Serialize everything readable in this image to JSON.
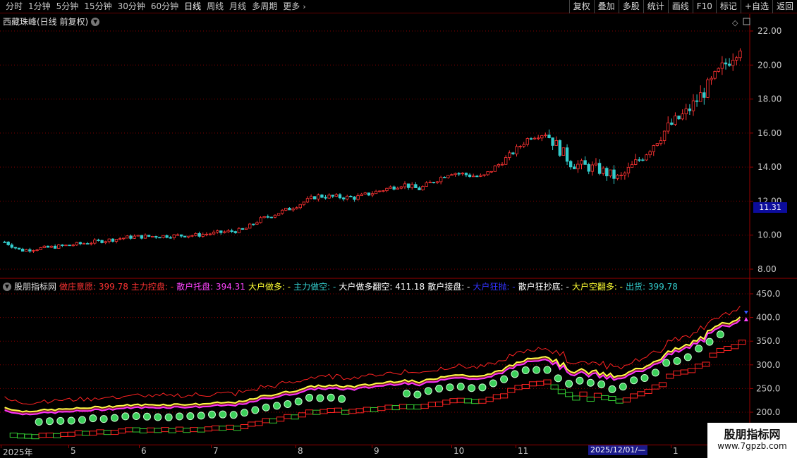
{
  "toolbar": {
    "periods": [
      "分时",
      "1分钟",
      "5分钟",
      "15分钟",
      "30分钟",
      "60分钟",
      "日线",
      "周线",
      "月线",
      "多周期",
      "更多"
    ],
    "active_period": "日线",
    "tools": [
      "复权",
      "叠加",
      "多股",
      "统计",
      "画线",
      "F10",
      "标记",
      "+自选",
      "返回"
    ]
  },
  "main": {
    "title": "西藏珠峰(日线 前复权)",
    "price_tag": "11.31",
    "y_ticks": [
      "22.00",
      "20.00",
      "18.00",
      "16.00",
      "14.00",
      "12.00",
      "10.00",
      "8.00"
    ]
  },
  "indicator": {
    "name": "股朋指标网",
    "items": [
      {
        "text": "做庄意愿: 399.78",
        "color": "#ff3333"
      },
      {
        "text": "主力控盘: -",
        "color": "#ff3333"
      },
      {
        "text": "散户托盘: 394.31",
        "color": "#ff44ff"
      },
      {
        "text": "大户做多: -",
        "color": "#ffff33"
      },
      {
        "text": "主力做空: -",
        "color": "#33cccc"
      },
      {
        "text": "大户做多翻空: 411.18",
        "color": "#ffffff"
      },
      {
        "text": "散户接盘: -",
        "color": "#ffffff"
      },
      {
        "text": "大户狂抛: -",
        "color": "#3333ff"
      },
      {
        "text": "散户狂抄底: -",
        "color": "#ffffff"
      },
      {
        "text": "大户空翻多: -",
        "color": "#ffff33"
      },
      {
        "text": "出货: 399.78",
        "color": "#33cccc"
      }
    ],
    "y_ticks": [
      "450.0",
      "400.0",
      "350.0",
      "300.0",
      "250.0",
      "200.0"
    ]
  },
  "xaxis": {
    "labels": [
      "2025年",
      "5",
      "6",
      "7",
      "8",
      "9",
      "10",
      "11",
      "1"
    ],
    "cursor_date": "2025/12/01/—"
  },
  "watermark": {
    "title": "股朋指标网",
    "url": "www.7gpzb.com"
  },
  "colors": {
    "up": "#ff3333",
    "down": "#33cccc",
    "grid": "#880000",
    "axis": "#c8c8c8"
  }
}
